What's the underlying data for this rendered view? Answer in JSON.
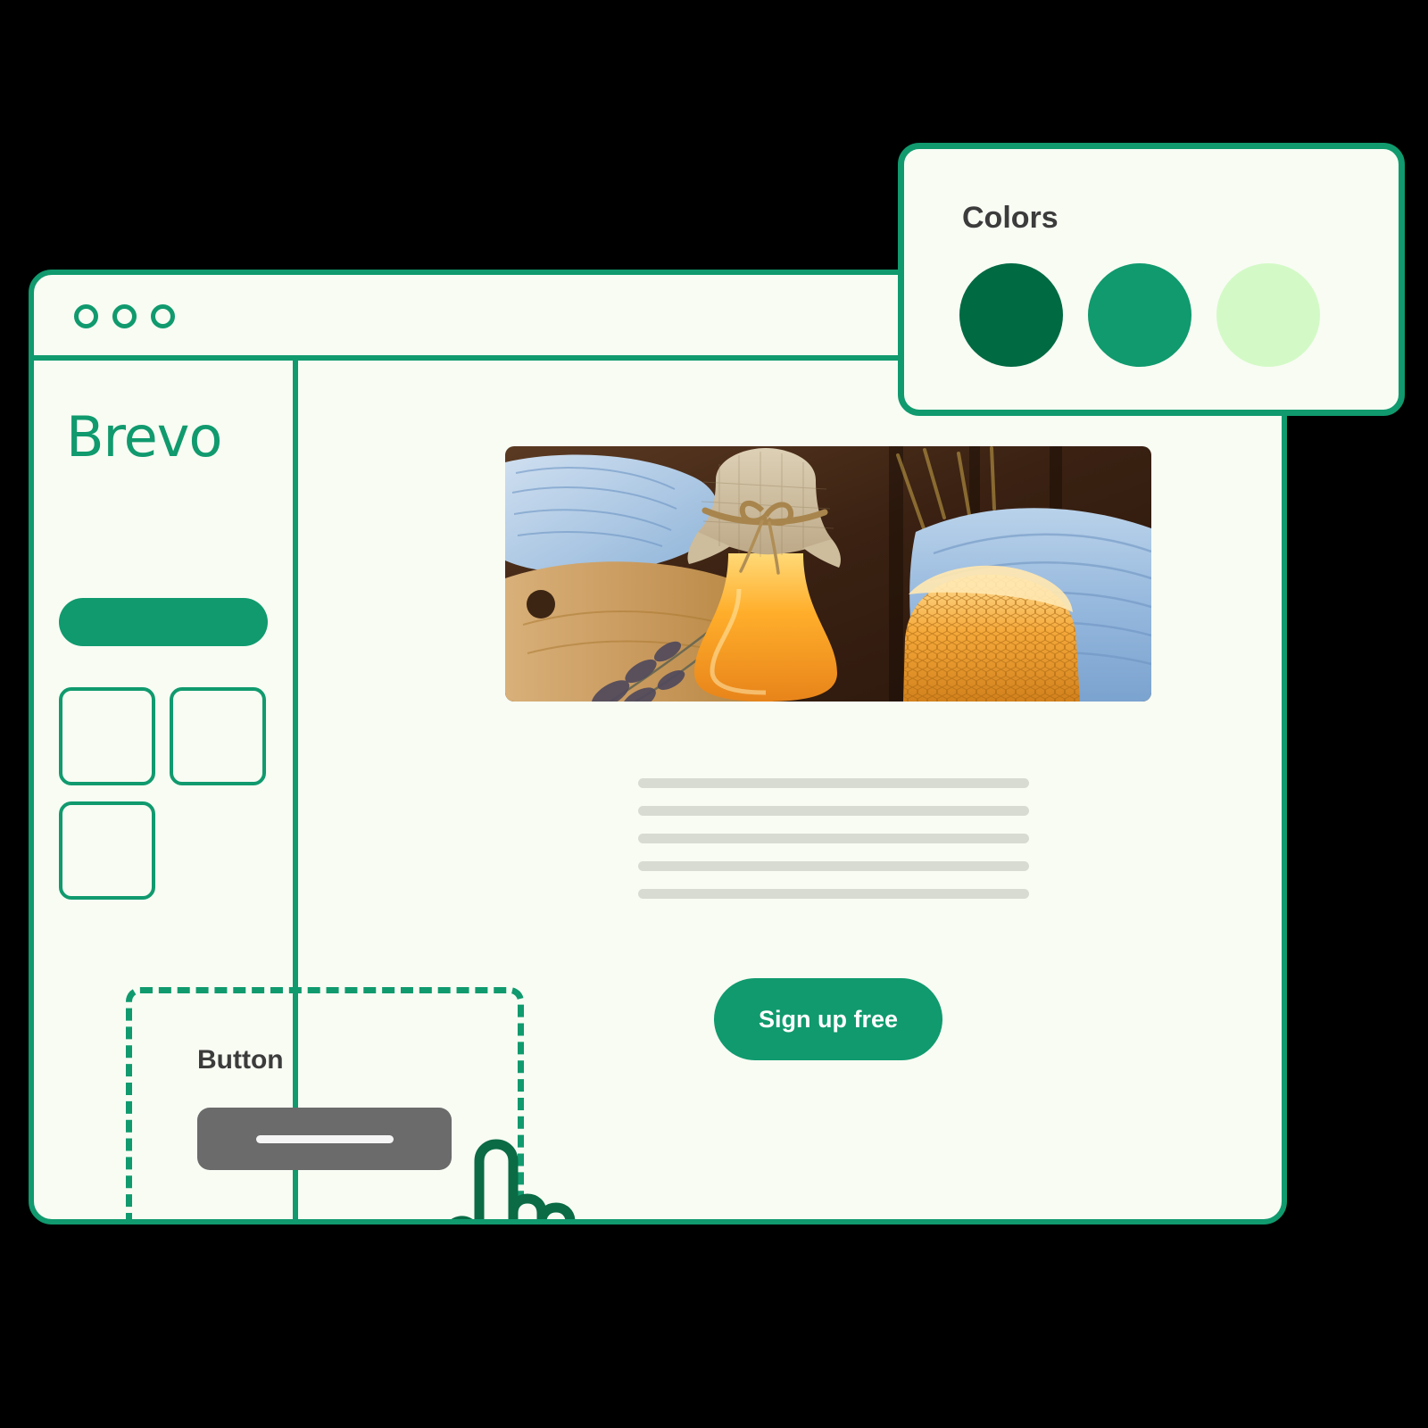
{
  "window": {
    "traffic_lights": [
      "close-dot",
      "minimize-dot",
      "maximize-dot"
    ]
  },
  "sidebar": {
    "brand": "Brevo",
    "blocks": [
      {
        "name": "sidebar-pill-block"
      },
      {
        "name": "sidebar-square-block-1"
      },
      {
        "name": "sidebar-square-block-2"
      },
      {
        "name": "sidebar-square-block-3"
      }
    ]
  },
  "editor": {
    "selected_block": {
      "label": "Button",
      "button_fill": "#6B6B6B"
    },
    "hero_image_alt": "honey jar with burlap lid, honeycomb, lavender on wooden board",
    "body_text_lines": 5,
    "cta": {
      "label": "Sign up free",
      "color": "#109A6E"
    }
  },
  "colors_panel": {
    "title": "Colors",
    "swatches": [
      {
        "name": "brand-dark-green",
        "hex": "#006A43"
      },
      {
        "name": "brand-green",
        "hex": "#109A6E"
      },
      {
        "name": "brand-light-green",
        "hex": "#D3FAC6"
      }
    ]
  },
  "cursor": {
    "icon": "pointing-hand-cursor",
    "color": "#0A6B45"
  }
}
